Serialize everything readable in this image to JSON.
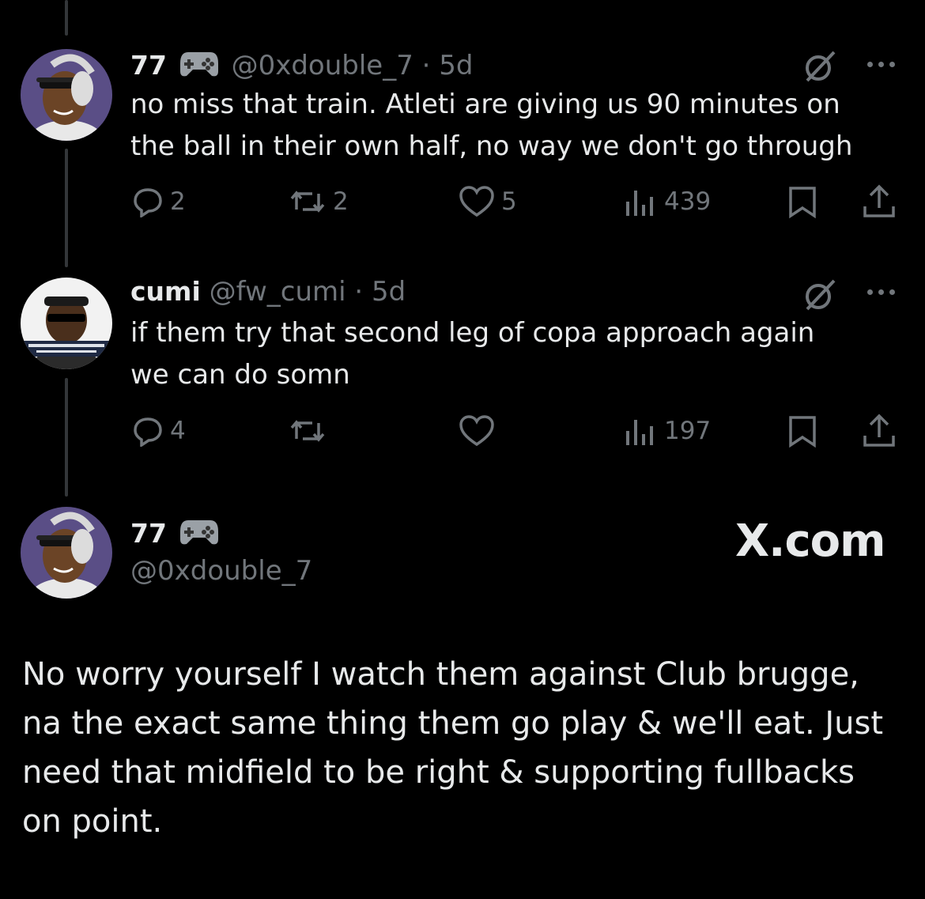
{
  "posts": [
    {
      "display_name": "77",
      "handle": "@0xdouble_7",
      "separator": "·",
      "time": "5d",
      "text_line1": "no miss that train. Atleti are giving us 90 minutes on",
      "text_line2": "the ball in their own half, no way we don't go through",
      "replies": "2",
      "reposts": "2",
      "likes": "5",
      "views": "439"
    },
    {
      "display_name": "cumi",
      "handle": "@fw_cumi",
      "separator": "·",
      "time": "5d",
      "text_line1": "if them try that second leg of copa approach again",
      "text_line2": "we can do somn",
      "replies": "4",
      "reposts": "",
      "likes": "",
      "views": "197"
    }
  ],
  "quote": {
    "display_name": "77",
    "handle": "@0xdouble_7",
    "brand": "X.com",
    "lines": [
      "No worry yourself I watch them against Club brugge,",
      "na the exact same thing them go play & we'll eat. Just",
      "need that midfield to be right & supporting fullbacks",
      "on point."
    ]
  },
  "colors": {
    "background": "#000000",
    "text": "#e7e9ea",
    "muted": "#71767b",
    "thread_line": "#333639"
  },
  "icons": [
    "gamepad-icon",
    "grok-icon",
    "more-icon",
    "reply-icon",
    "repost-icon",
    "like-icon",
    "views-icon",
    "bookmark-icon",
    "share-icon"
  ]
}
